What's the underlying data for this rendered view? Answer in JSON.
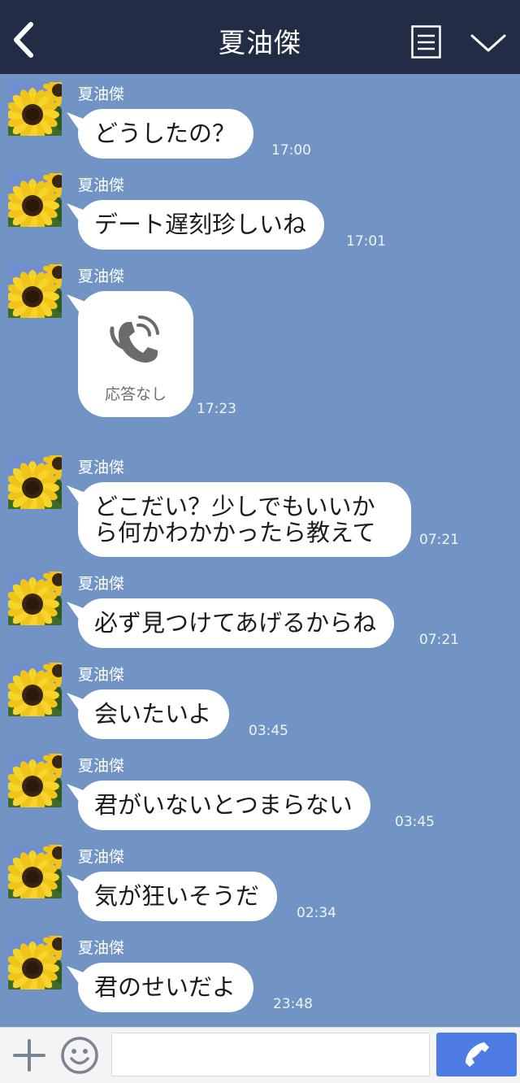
{
  "header": {
    "title": "夏油傑",
    "back_icon": "chevron-left-icon",
    "menu_icon": "notes-icon",
    "collapse_icon": "chevron-down-icon"
  },
  "messages": [
    {
      "sender": "夏油傑",
      "text": "どうしたの？",
      "time": "17:00"
    },
    {
      "sender": "夏油傑",
      "text": "デート遅刻珍しいね",
      "time": "17:01"
    },
    {
      "sender": "夏油傑",
      "call_label": "応答なし",
      "time": "17:23"
    },
    {
      "sender": "夏油傑",
      "text": "どこだい？少しでもいいから何かわかかったら教えて",
      "time": "07:21"
    },
    {
      "sender": "夏油傑",
      "text": "必ず見つけてあげるからね",
      "time": "07:21"
    },
    {
      "sender": "夏油傑",
      "text": "会いたいよ",
      "time": "03:45"
    },
    {
      "sender": "夏油傑",
      "text": "君がいないとつまらない",
      "time": "03:45"
    },
    {
      "sender": "夏油傑",
      "text": "気が狂いそうだ",
      "time": "02:34"
    },
    {
      "sender": "夏油傑",
      "text": "君のせいだよ",
      "time": "23:48"
    }
  ],
  "footer": {
    "plus_icon": "plus-icon",
    "emoji_icon": "smiley-icon",
    "input_placeholder": "",
    "send_icon": "phone-icon"
  },
  "colors": {
    "header_bg": "#222d45",
    "chat_bg": "#7294c4",
    "bubble_bg": "#ffffff",
    "send_button": "#4d7de3"
  }
}
